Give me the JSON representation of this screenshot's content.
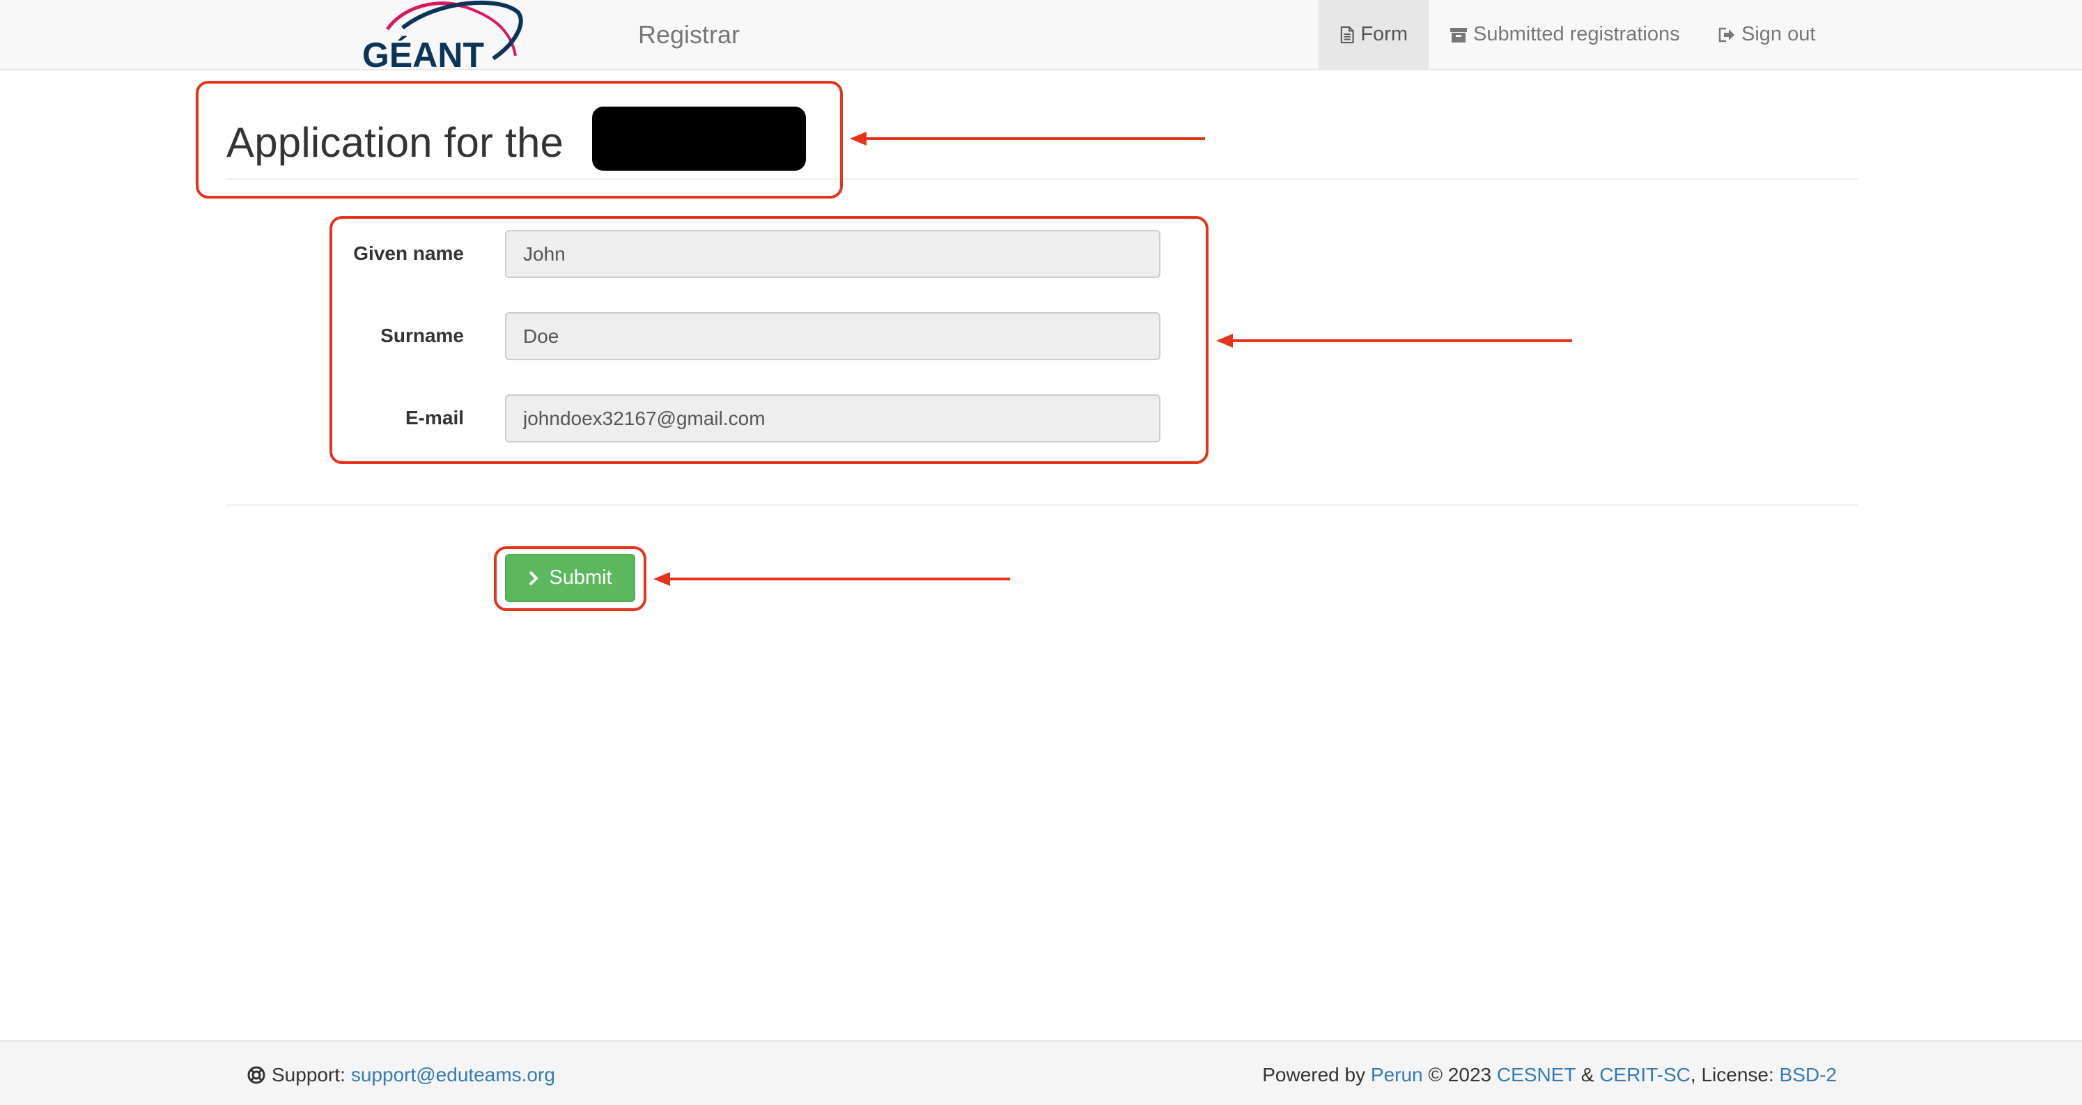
{
  "navbar": {
    "brand_logo_text": "GÉANT",
    "title": "Registrar",
    "items": [
      {
        "label": "Form",
        "icon": "document-icon",
        "active": true
      },
      {
        "label": "Submitted registrations",
        "icon": "archive-icon",
        "active": false
      },
      {
        "label": "Sign out",
        "icon": "sign-out-icon",
        "active": false
      }
    ]
  },
  "main": {
    "title": "Application for the",
    "fields": [
      {
        "label": "Given name",
        "value": "John"
      },
      {
        "label": "Surname",
        "value": "Doe"
      },
      {
        "label": "E-mail",
        "value": "johndoex32167@gmail.com"
      }
    ],
    "submit_label": "Submit"
  },
  "footer": {
    "support_label": "Support:",
    "support_email": "support@eduteams.org",
    "powered_by": "Powered by",
    "perun": "Perun",
    "copyright": "© 2023",
    "cesnet": "CESNET",
    "amp": "&",
    "cerit": "CERIT-SC",
    "license_label": ", License:",
    "license": "BSD-2"
  },
  "colors": {
    "accent_link": "#337ab7",
    "submit_green": "#5cb85c",
    "annotation_red": "#e6331c",
    "logo_navy": "#0a3558",
    "logo_magenta": "#d9195f"
  }
}
